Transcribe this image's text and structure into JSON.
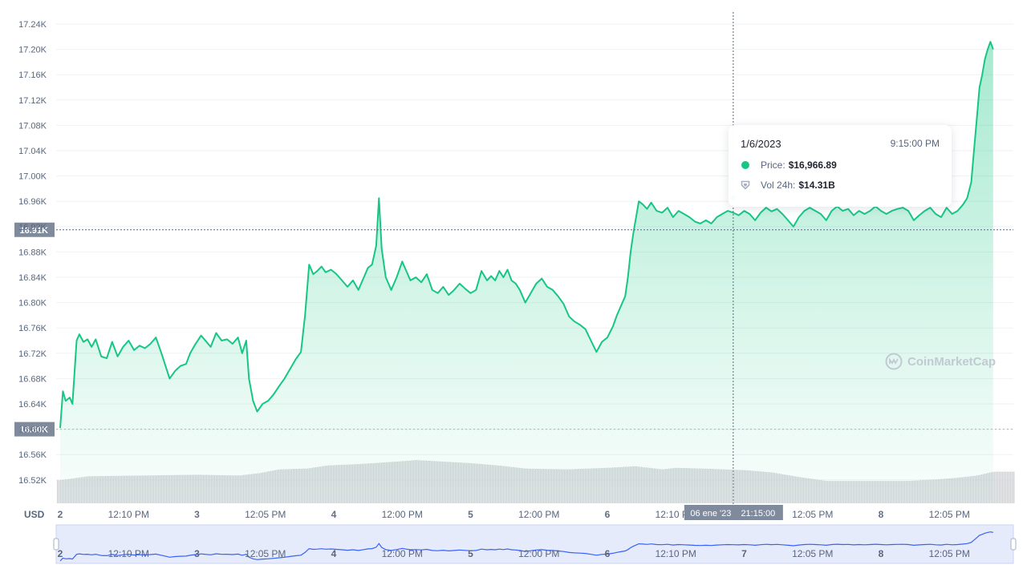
{
  "chart_data": {
    "type": "area",
    "currency": "USD",
    "colors": {
      "line": "#16c784",
      "area_top": "#16c784",
      "volume": "#a6b0c3",
      "crosshair": "#58667e"
    },
    "y_ticks": [
      "17.24K",
      "17.20K",
      "17.16K",
      "17.12K",
      "17.08K",
      "17.04K",
      "17.00K",
      "16.96K",
      "16.92K",
      "16.88K",
      "16.84K",
      "16.80K",
      "16.76K",
      "16.72K",
      "16.68K",
      "16.64K",
      "16.60K",
      "16.56K",
      "16.52K"
    ],
    "y_highlight_labels": {
      "crosshair": "16.91K",
      "baseline": "16.60K"
    },
    "x_ticks": [
      {
        "label": "2",
        "major": true,
        "t": 0.0
      },
      {
        "label": "12:10 PM",
        "major": false,
        "t": 0.5
      },
      {
        "label": "3",
        "major": true,
        "t": 1.0
      },
      {
        "label": "12:05 PM",
        "major": false,
        "t": 1.5
      },
      {
        "label": "4",
        "major": true,
        "t": 2.0
      },
      {
        "label": "12:00 PM",
        "major": false,
        "t": 2.5
      },
      {
        "label": "5",
        "major": true,
        "t": 3.0
      },
      {
        "label": "12:00 PM",
        "major": false,
        "t": 3.5
      },
      {
        "label": "6",
        "major": true,
        "t": 4.0
      },
      {
        "label": "12:10 PM",
        "major": false,
        "t": 4.5
      },
      {
        "label": "7",
        "major": true,
        "t": 5.0
      },
      {
        "label": "12:05 PM",
        "major": false,
        "t": 5.5
      },
      {
        "label": "8",
        "major": true,
        "t": 6.0
      },
      {
        "label": "12:05 PM",
        "major": false,
        "t": 6.5
      }
    ],
    "x_crosshair_label": {
      "date": "06 ene '23",
      "time": "21:15:00"
    },
    "price_points": [
      [
        0.0,
        16602
      ],
      [
        0.02,
        16660
      ],
      [
        0.04,
        16645
      ],
      [
        0.07,
        16650
      ],
      [
        0.09,
        16640
      ],
      [
        0.12,
        16740
      ],
      [
        0.14,
        16750
      ],
      [
        0.17,
        16738
      ],
      [
        0.2,
        16742
      ],
      [
        0.23,
        16730
      ],
      [
        0.26,
        16742
      ],
      [
        0.3,
        16715
      ],
      [
        0.34,
        16712
      ],
      [
        0.38,
        16738
      ],
      [
        0.42,
        16715
      ],
      [
        0.46,
        16730
      ],
      [
        0.5,
        16740
      ],
      [
        0.54,
        16725
      ],
      [
        0.58,
        16732
      ],
      [
        0.62,
        16728
      ],
      [
        0.66,
        16735
      ],
      [
        0.7,
        16745
      ],
      [
        0.74,
        16720
      ],
      [
        0.77,
        16700
      ],
      [
        0.8,
        16680
      ],
      [
        0.84,
        16692
      ],
      [
        0.88,
        16700
      ],
      [
        0.92,
        16703
      ],
      [
        0.95,
        16720
      ],
      [
        0.99,
        16735
      ],
      [
        1.03,
        16748
      ],
      [
        1.07,
        16738
      ],
      [
        1.1,
        16730
      ],
      [
        1.14,
        16752
      ],
      [
        1.18,
        16740
      ],
      [
        1.22,
        16742
      ],
      [
        1.26,
        16735
      ],
      [
        1.3,
        16745
      ],
      [
        1.33,
        16720
      ],
      [
        1.36,
        16740
      ],
      [
        1.38,
        16680
      ],
      [
        1.41,
        16645
      ],
      [
        1.44,
        16628
      ],
      [
        1.48,
        16640
      ],
      [
        1.52,
        16645
      ],
      [
        1.56,
        16655
      ],
      [
        1.6,
        16668
      ],
      [
        1.64,
        16680
      ],
      [
        1.68,
        16695
      ],
      [
        1.72,
        16710
      ],
      [
        1.76,
        16722
      ],
      [
        1.79,
        16780
      ],
      [
        1.82,
        16860
      ],
      [
        1.85,
        16845
      ],
      [
        1.88,
        16850
      ],
      [
        1.91,
        16857
      ],
      [
        1.94,
        16848
      ],
      [
        1.98,
        16852
      ],
      [
        2.02,
        16845
      ],
      [
        2.06,
        16835
      ],
      [
        2.1,
        16825
      ],
      [
        2.14,
        16835
      ],
      [
        2.18,
        16820
      ],
      [
        2.22,
        16840
      ],
      [
        2.25,
        16855
      ],
      [
        2.28,
        16860
      ],
      [
        2.31,
        16890
      ],
      [
        2.33,
        16965
      ],
      [
        2.35,
        16885
      ],
      [
        2.38,
        16840
      ],
      [
        2.42,
        16820
      ],
      [
        2.46,
        16840
      ],
      [
        2.5,
        16865
      ],
      [
        2.53,
        16850
      ],
      [
        2.56,
        16835
      ],
      [
        2.6,
        16840
      ],
      [
        2.64,
        16832
      ],
      [
        2.68,
        16845
      ],
      [
        2.72,
        16820
      ],
      [
        2.76,
        16815
      ],
      [
        2.8,
        16825
      ],
      [
        2.84,
        16812
      ],
      [
        2.88,
        16820
      ],
      [
        2.92,
        16830
      ],
      [
        2.96,
        16822
      ],
      [
        3.0,
        16815
      ],
      [
        3.04,
        16820
      ],
      [
        3.08,
        16850
      ],
      [
        3.12,
        16835
      ],
      [
        3.15,
        16842
      ],
      [
        3.18,
        16835
      ],
      [
        3.21,
        16850
      ],
      [
        3.24,
        16840
      ],
      [
        3.27,
        16852
      ],
      [
        3.3,
        16835
      ],
      [
        3.33,
        16830
      ],
      [
        3.36,
        16820
      ],
      [
        3.4,
        16800
      ],
      [
        3.44,
        16815
      ],
      [
        3.48,
        16830
      ],
      [
        3.52,
        16838
      ],
      [
        3.56,
        16825
      ],
      [
        3.6,
        16820
      ],
      [
        3.64,
        16810
      ],
      [
        3.68,
        16798
      ],
      [
        3.72,
        16778
      ],
      [
        3.76,
        16770
      ],
      [
        3.8,
        16765
      ],
      [
        3.84,
        16758
      ],
      [
        3.88,
        16740
      ],
      [
        3.92,
        16722
      ],
      [
        3.96,
        16738
      ],
      [
        4.0,
        16745
      ],
      [
        4.04,
        16762
      ],
      [
        4.07,
        16780
      ],
      [
        4.1,
        16795
      ],
      [
        4.13,
        16810
      ],
      [
        4.15,
        16840
      ],
      [
        4.17,
        16880
      ],
      [
        4.19,
        16910
      ],
      [
        4.21,
        16935
      ],
      [
        4.23,
        16960
      ],
      [
        4.26,
        16955
      ],
      [
        4.29,
        16948
      ],
      [
        4.32,
        16958
      ],
      [
        4.36,
        16945
      ],
      [
        4.4,
        16942
      ],
      [
        4.44,
        16950
      ],
      [
        4.48,
        16935
      ],
      [
        4.52,
        16945
      ],
      [
        4.56,
        16940
      ],
      [
        4.6,
        16935
      ],
      [
        4.64,
        16928
      ],
      [
        4.68,
        16925
      ],
      [
        4.72,
        16930
      ],
      [
        4.76,
        16925
      ],
      [
        4.8,
        16935
      ],
      [
        4.84,
        16940
      ],
      [
        4.88,
        16945
      ],
      [
        4.92,
        16942
      ],
      [
        4.96,
        16938
      ],
      [
        5.0,
        16945
      ],
      [
        5.04,
        16940
      ],
      [
        5.08,
        16930
      ],
      [
        5.12,
        16942
      ],
      [
        5.16,
        16950
      ],
      [
        5.2,
        16944
      ],
      [
        5.24,
        16948
      ],
      [
        5.28,
        16940
      ],
      [
        5.32,
        16930
      ],
      [
        5.36,
        16920
      ],
      [
        5.4,
        16935
      ],
      [
        5.44,
        16945
      ],
      [
        5.48,
        16950
      ],
      [
        5.52,
        16945
      ],
      [
        5.56,
        16940
      ],
      [
        5.6,
        16930
      ],
      [
        5.64,
        16945
      ],
      [
        5.68,
        16952
      ],
      [
        5.72,
        16945
      ],
      [
        5.76,
        16948
      ],
      [
        5.8,
        16938
      ],
      [
        5.84,
        16945
      ],
      [
        5.88,
        16940
      ],
      [
        5.92,
        16945
      ],
      [
        5.96,
        16952
      ],
      [
        6.0,
        16945
      ],
      [
        6.04,
        16940
      ],
      [
        6.08,
        16945
      ],
      [
        6.12,
        16948
      ],
      [
        6.16,
        16950
      ],
      [
        6.2,
        16945
      ],
      [
        6.24,
        16930
      ],
      [
        6.28,
        16938
      ],
      [
        6.32,
        16945
      ],
      [
        6.36,
        16950
      ],
      [
        6.4,
        16940
      ],
      [
        6.44,
        16935
      ],
      [
        6.48,
        16950
      ],
      [
        6.52,
        16940
      ],
      [
        6.56,
        16945
      ],
      [
        6.6,
        16955
      ],
      [
        6.63,
        16965
      ],
      [
        6.66,
        16990
      ],
      [
        6.68,
        17040
      ],
      [
        6.7,
        17090
      ],
      [
        6.72,
        17140
      ],
      [
        6.74,
        17160
      ],
      [
        6.76,
        17185
      ],
      [
        6.78,
        17200
      ],
      [
        6.8,
        17212
      ],
      [
        6.82,
        17200
      ]
    ],
    "volume_levels": [
      [
        0.0,
        0.3
      ],
      [
        0.2,
        0.35
      ],
      [
        0.6,
        0.36
      ],
      [
        1.0,
        0.37
      ],
      [
        1.3,
        0.36
      ],
      [
        1.45,
        0.39
      ],
      [
        1.6,
        0.44
      ],
      [
        1.8,
        0.45
      ],
      [
        1.95,
        0.49
      ],
      [
        2.2,
        0.51
      ],
      [
        2.45,
        0.54
      ],
      [
        2.6,
        0.56
      ],
      [
        2.8,
        0.54
      ],
      [
        3.0,
        0.52
      ],
      [
        3.2,
        0.49
      ],
      [
        3.4,
        0.45
      ],
      [
        3.7,
        0.44
      ],
      [
        4.0,
        0.46
      ],
      [
        4.2,
        0.48
      ],
      [
        4.3,
        0.46
      ],
      [
        4.4,
        0.44
      ],
      [
        4.5,
        0.46
      ],
      [
        4.7,
        0.45
      ],
      [
        5.0,
        0.43
      ],
      [
        5.2,
        0.4
      ],
      [
        5.4,
        0.34
      ],
      [
        5.6,
        0.29
      ],
      [
        5.8,
        0.29
      ],
      [
        6.0,
        0.29
      ],
      [
        6.2,
        0.29
      ],
      [
        6.4,
        0.31
      ],
      [
        6.55,
        0.33
      ],
      [
        6.7,
        0.36
      ],
      [
        6.82,
        0.41
      ]
    ],
    "crosshair_t": 4.92
  },
  "tooltip": {
    "date": "1/6/2023",
    "time": "9:15:00 PM",
    "price_label": "Price:",
    "price_value": "$16,966.89",
    "vol_label": "Vol 24h:",
    "vol_value": "$14.31B"
  },
  "watermark": "CoinMarketCap",
  "navigator_ticks": [
    "2",
    "12:10 PM",
    "3",
    "12:05 PM",
    "4",
    "12:00 PM",
    "5",
    "12:00 PM",
    "6",
    "12:10 PM",
    "7",
    "12:05 PM",
    "8",
    "12:05 PM"
  ]
}
